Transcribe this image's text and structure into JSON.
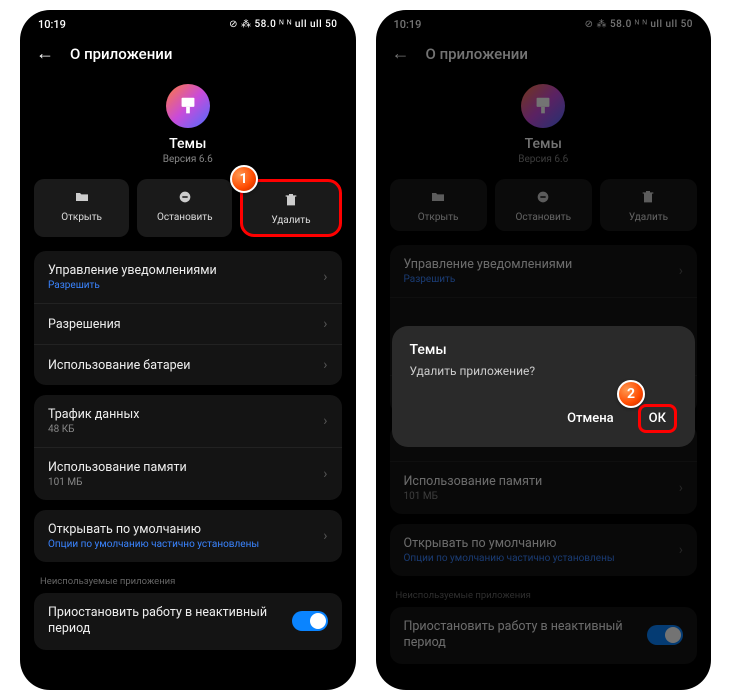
{
  "statusbar": {
    "time": "10:19",
    "right_icons": "⊘ ⁂ 58.0 ᴺ ᴺ ull ull 50"
  },
  "header": {
    "title": "О приложении"
  },
  "app": {
    "name": "Темы",
    "version": "Версия 6.6"
  },
  "actions": {
    "open": "Открыть",
    "stop": "Остановить",
    "delete": "Удалить"
  },
  "badge1": "1",
  "badge2": "2",
  "rows": {
    "notifications": {
      "title": "Управление уведомлениями",
      "sub": "Разрешить"
    },
    "permissions": {
      "title": "Разрешения"
    },
    "battery": {
      "title": "Использование батареи"
    },
    "traffic": {
      "title": "Трафик данных",
      "sub": "48 КБ"
    },
    "memory": {
      "title": "Использование памяти",
      "sub": "101 МБ"
    },
    "defaults": {
      "title": "Открывать по умолчанию",
      "sub": "Опции по умолчанию частично установлены"
    }
  },
  "section_unused": "Неиспользуемые приложения",
  "toggle_row": "Приостановить работу в неактивный период",
  "dialog": {
    "title": "Темы",
    "message": "Удалить приложение?",
    "cancel": "Отмена",
    "ok": "ОК"
  }
}
